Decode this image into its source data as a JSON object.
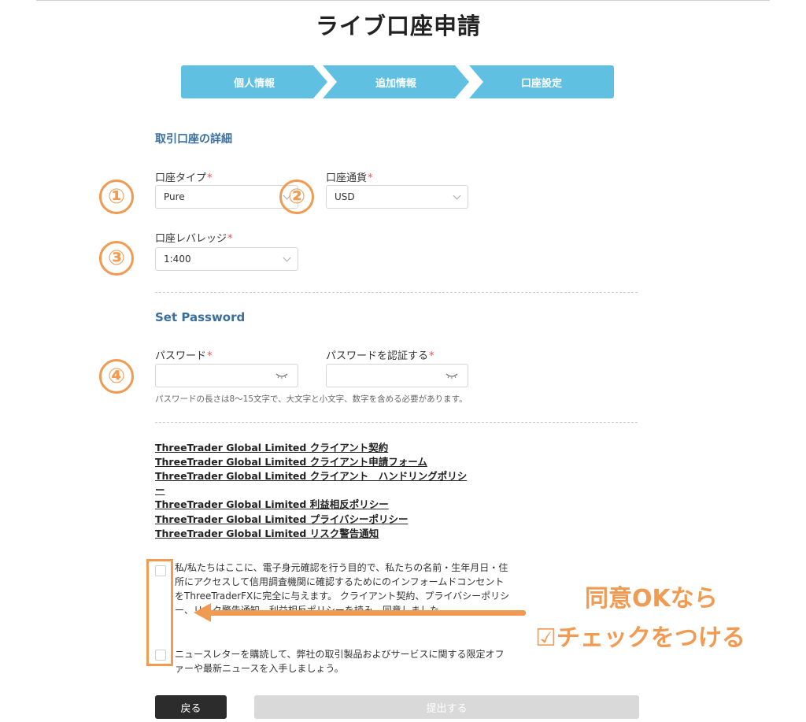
{
  "page": {
    "title": "ライブ口座申請"
  },
  "steps": [
    "個人情報",
    "追加情報",
    "口座設定"
  ],
  "account_section": {
    "title": "取引口座の詳細",
    "account_type": {
      "label": "口座タイプ",
      "value": "Pure"
    },
    "currency": {
      "label": "口座通貨",
      "value": "USD"
    },
    "leverage": {
      "label": "口座レバレッジ",
      "value": "1:400"
    }
  },
  "password_section": {
    "title": "Set Password",
    "password_label": "パスワード",
    "confirm_label": "パスワードを認証する",
    "hint": "パスワードの長さは8〜15文字で、大文字と小文字、数字を含める必要があります。"
  },
  "required_mark": "*",
  "links": [
    "ThreeTrader Global Limited クライアント契約",
    "ThreeTrader Global Limited クライアント申請フォーム",
    "ThreeTrader Global Limited クライアント　ハンドリングポリシ",
    "ー",
    "ThreeTrader Global Limited 利益相反ポリシー",
    "ThreeTrader Global Limited プライバシーポリシー",
    "ThreeTrader Global Limited リスク警告通知"
  ],
  "consent": {
    "terms_text": "私/私たちはここに、電子身元確認を行う目的で、私たちの名前・生年月日・住所にアクセスして信用調査機関に確認するためにのインフォームドコンセントをThreeTraderFXに完全に与えます。 クライアント契約、プライバシーポリシー、リスク警告通知、利益相反ポリシーを読み、同意しました。",
    "newsletter_text": "ニュースレターを購読して、弊社の取引製品およびサービスに関する限定オファーや最新ニュースを入手しましょう。"
  },
  "annotations": {
    "badges": [
      "①",
      "②",
      "③",
      "④"
    ],
    "line1": "同意OKなら",
    "line2": "☑チェックをつける",
    "accent_color": "#f19a52"
  },
  "buttons": {
    "back": "戻る",
    "submit": "提出する"
  },
  "colors": {
    "step_bg": "#5fc0e2",
    "section_title": "#3a6e9e",
    "back_button": "#2c2c2c",
    "submit_disabled": "#d9d9d9"
  }
}
